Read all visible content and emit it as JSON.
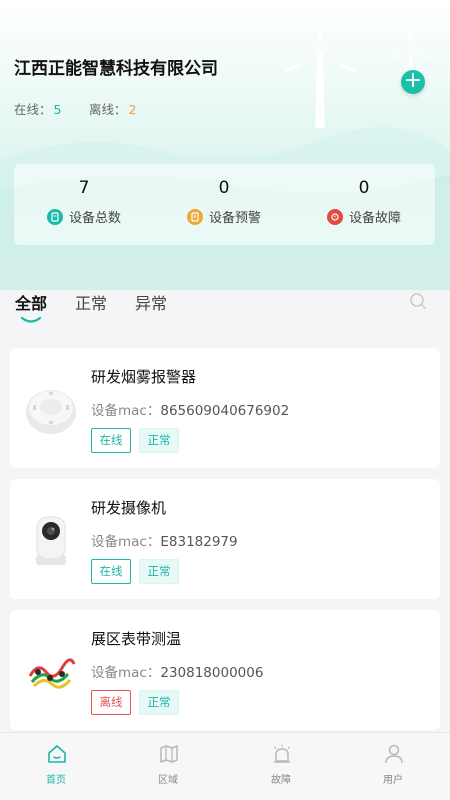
{
  "header": {
    "company": "江西正能智慧科技有限公司",
    "online_label": "在线：",
    "online_count": "5",
    "offline_label": "离线：",
    "offline_count": "2",
    "add_icon": "plus-icon"
  },
  "stats": [
    {
      "value": "7",
      "label": "设备总数",
      "icon": "device-total-icon",
      "color": "#1cb9a8"
    },
    {
      "value": "0",
      "label": "设备预警",
      "icon": "warning-icon",
      "color": "#f0a73a"
    },
    {
      "value": "0",
      "label": "设备故障",
      "icon": "fault-icon",
      "color": "#e44b40"
    }
  ],
  "tabs": [
    "全部",
    "正常",
    "异常"
  ],
  "active_tab": "全部",
  "devices": [
    {
      "name": "研发烟雾报警器",
      "mac_label": "设备mac：",
      "mac": "865609040676902",
      "connection": "在线",
      "state": "正常",
      "icon": "smoke-detector-icon"
    },
    {
      "name": "研发摄像机",
      "mac_label": "设备mac：",
      "mac": "E83182979",
      "connection": "在线",
      "state": "正常",
      "icon": "camera-icon"
    },
    {
      "name": "展区表带测温",
      "mac_label": "设备mac：",
      "mac": "230818000006",
      "connection": "离线",
      "state": "正常",
      "icon": "temperature-strap-icon"
    }
  ],
  "nav": [
    {
      "label": "首页",
      "icon": "home-icon"
    },
    {
      "label": "区域",
      "icon": "map-icon"
    },
    {
      "label": "故障",
      "icon": "alarm-icon"
    },
    {
      "label": "用户",
      "icon": "user-icon"
    }
  ],
  "colors": {
    "accent": "#1fb5a6",
    "offline": "#e9a23a",
    "error": "#e25555"
  }
}
